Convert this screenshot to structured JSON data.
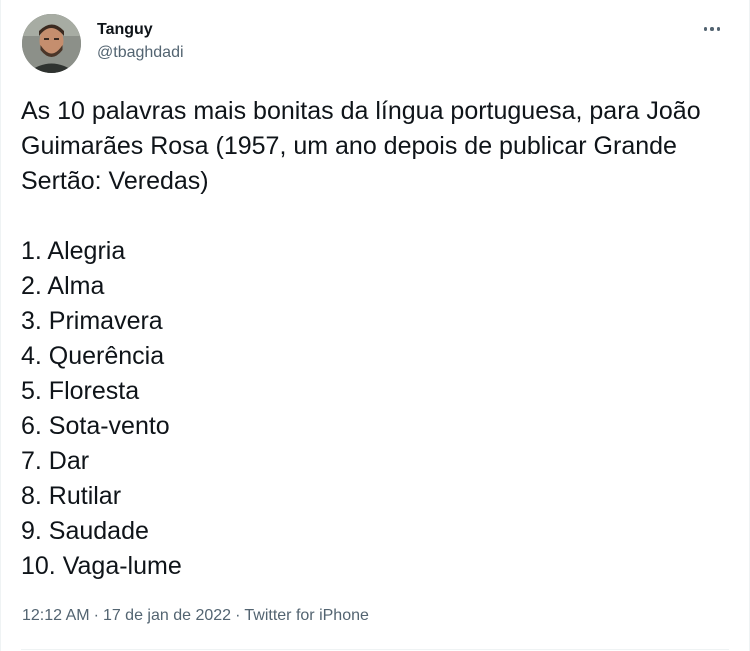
{
  "author": {
    "display_name": "Tanguy",
    "handle": "@tbaghdadi"
  },
  "tweet": {
    "intro": "As 10 palavras mais bonitas da língua portuguesa, para João Guimarães Rosa (1957, um ano depois de publicar Grande Sertão: Veredas)",
    "list": [
      "1. Alegria",
      "2. Alma",
      "3. Primavera",
      "4. Querência",
      "5. Floresta",
      "6. Sota-vento",
      "7. Dar",
      "8. Rutilar",
      "9. Saudade",
      "10. Vaga-lume"
    ]
  },
  "meta": {
    "time": "12:12 AM",
    "separator": "·",
    "date": "17 de jan de 2022",
    "source": "Twitter for iPhone"
  },
  "icons": {
    "more": "more-horizontal-icon"
  },
  "colors": {
    "text_primary": "#0f1419",
    "text_secondary": "#536471",
    "border": "#eff3f4"
  }
}
